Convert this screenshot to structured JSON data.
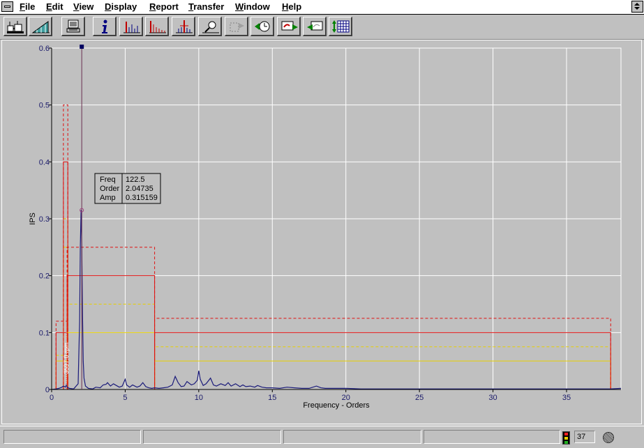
{
  "menu": [
    {
      "accel": "F",
      "rest": "ile"
    },
    {
      "accel": "E",
      "rest": "dit"
    },
    {
      "accel": "V",
      "rest": "iew"
    },
    {
      "accel": "D",
      "rest": "isplay"
    },
    {
      "accel": "R",
      "rest": "eport"
    },
    {
      "accel": "T",
      "rest": "ransfer"
    },
    {
      "accel": "W",
      "rest": "indow"
    },
    {
      "accel": "H",
      "rest": "elp"
    }
  ],
  "toolbar_icons": [
    "machine-train-icon",
    "ramp-chart-icon",
    "computer-icon",
    "info-icon",
    "spectrum-icon",
    "spectrum-decay-icon",
    "spectrum-marker-icon",
    "zoom-magnifier-icon",
    "next-disabled-icon",
    "clock-navigate-icon",
    "transfer-out-icon",
    "transfer-in-icon",
    "grid-table-icon"
  ],
  "chart_data": {
    "type": "line",
    "xlabel": "Frequency - Orders",
    "ylabel": "IPS",
    "xlim": [
      0,
      38.7
    ],
    "ylim": [
      0,
      0.6
    ],
    "xticks": [
      0,
      5,
      10,
      15,
      20,
      25,
      30,
      35
    ],
    "yticks": [
      0,
      0.1,
      0.2,
      0.3,
      0.4,
      0.5,
      0.6
    ],
    "grid": true,
    "background": "#c0c0c0",
    "series_color": "#1a1a7a",
    "series": [
      {
        "x": [
          0,
          0.3,
          0.5,
          0.7,
          0.8,
          0.95,
          1.0,
          1.05,
          1.2,
          1.5,
          1.8,
          1.9,
          1.95,
          2.0,
          2.05,
          2.1,
          2.15,
          2.2,
          2.3,
          2.5,
          2.8,
          3.0,
          3.3,
          3.5,
          3.7,
          3.8,
          4.0,
          4.2,
          4.4,
          4.6,
          4.8,
          5.0,
          5.1,
          5.3,
          5.5,
          5.8,
          6.0,
          6.2,
          6.4,
          6.6,
          6.8,
          7.0,
          7.3,
          7.6,
          7.9,
          8.2,
          8.4,
          8.6,
          8.8,
          9.0,
          9.2,
          9.5,
          9.7,
          9.9,
          10.0,
          10.1,
          10.3,
          10.5,
          10.8,
          11.0,
          11.2,
          11.5,
          11.8,
          12.0,
          12.2,
          12.5,
          12.8,
          13.0,
          13.2,
          13.5,
          13.8,
          14.0,
          14.3,
          14.6,
          15.0,
          15.5,
          16.0,
          16.5,
          17.0,
          17.5,
          18.0,
          18.3,
          18.6,
          19.0,
          20.0,
          21.0,
          22.0,
          23.0,
          24.0,
          25.0,
          26.0,
          27.0,
          28.0,
          29.0,
          30.0,
          31.0,
          32.0,
          33.0,
          34.0,
          35.0,
          36.0,
          37.0,
          38.0,
          38.7
        ],
        "y": [
          0,
          0.001,
          0.002,
          0.004,
          0.006,
          0.004,
          0.009,
          0.004,
          0.002,
          0.001,
          0.01,
          0.12,
          0.25,
          0.3152,
          0.25,
          0.13,
          0.05,
          0.02,
          0.006,
          0.002,
          0.001,
          0.004,
          0.003,
          0.008,
          0.009,
          0.012,
          0.006,
          0.01,
          0.007,
          0.004,
          0.006,
          0.018,
          0.008,
          0.004,
          0.008,
          0.004,
          0.006,
          0.012,
          0.005,
          0.003,
          0.002,
          0.003,
          0.002,
          0.003,
          0.004,
          0.008,
          0.023,
          0.012,
          0.005,
          0.006,
          0.014,
          0.008,
          0.01,
          0.016,
          0.033,
          0.018,
          0.007,
          0.01,
          0.02,
          0.008,
          0.006,
          0.01,
          0.007,
          0.012,
          0.006,
          0.01,
          0.005,
          0.008,
          0.005,
          0.006,
          0.004,
          0.007,
          0.004,
          0.003,
          0.003,
          0.002,
          0.004,
          0.003,
          0.002,
          0.002,
          0.006,
          0.003,
          0.002,
          0.002,
          0.002,
          0.001,
          0.001,
          0.001,
          0.001,
          0.001,
          0.001,
          0.001,
          0.001,
          0.001,
          0.001,
          0.001,
          0.001,
          0.001,
          0.001,
          0.001,
          0.001,
          0.001,
          0.001,
          0.002
        ]
      }
    ],
    "alarm_bands": [
      {
        "x1": 0.3,
        "x2": 1.05,
        "alert": 0.12,
        "danger": 0.1,
        "warn2": 0.06,
        "warn1": 0.05
      },
      {
        "x1": 0.8,
        "x2": 1.1,
        "alert": 0.5,
        "danger": 0.4,
        "warn2": 0.3,
        "warn1": 0.25
      },
      {
        "x1": 1.05,
        "x2": 7.0,
        "alert": 0.25,
        "danger": 0.2,
        "warn2": 0.15,
        "warn1": 0.1
      },
      {
        "x1": 7.0,
        "x2": 38.0,
        "alert": 0.125,
        "danger": 0.1,
        "warn2": 0.075,
        "warn1": 0.05
      }
    ],
    "alarm_colors": {
      "red": "#e01010",
      "yellow": "#e8d000"
    },
    "speed_marker": {
      "x": 1.0,
      "label": "3597.0 rpm"
    },
    "cursor": {
      "x": 2.04735,
      "y": 0.315159,
      "rows": [
        {
          "name": "Freq",
          "value": "122.5"
        },
        {
          "name": "Order",
          "value": "2.04735"
        },
        {
          "name": "Amp",
          "value": "0.315159"
        }
      ]
    }
  },
  "status": {
    "count": "37",
    "traffic_colors": [
      "#ff2020",
      "#e8d000",
      "#20b020"
    ]
  }
}
